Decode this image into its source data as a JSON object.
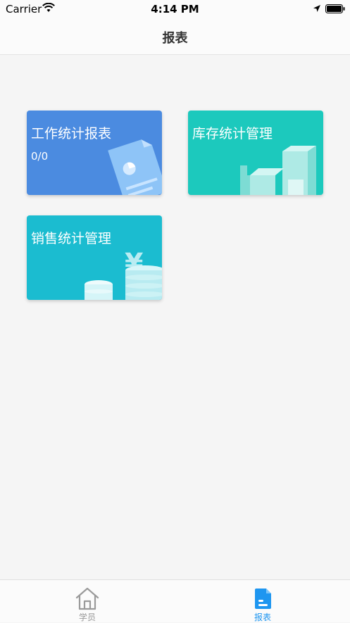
{
  "status_bar": {
    "carrier": "Carrier",
    "time": "4:14 PM",
    "icons": [
      "wifi-icon",
      "location-arrow-icon",
      "battery-icon"
    ]
  },
  "nav": {
    "title": "报表"
  },
  "cards": [
    {
      "title": "工作统计报表",
      "count": "0/0",
      "color": "#4b8be0",
      "icon": "document-chart-icon"
    },
    {
      "title": "库存统计管理",
      "color": "#1cc9bd",
      "icon": "boxes-icon"
    },
    {
      "title": "销售统计管理",
      "color": "#1bbcd0",
      "icon": "yuan-coins-icon"
    }
  ],
  "tab_bar": {
    "active_color": "#1e96f0",
    "inactive_color": "#999999",
    "tabs": [
      {
        "label": "学员",
        "icon": "house-icon",
        "active": false
      },
      {
        "label": "报表",
        "icon": "report-document-icon",
        "active": true
      }
    ]
  }
}
